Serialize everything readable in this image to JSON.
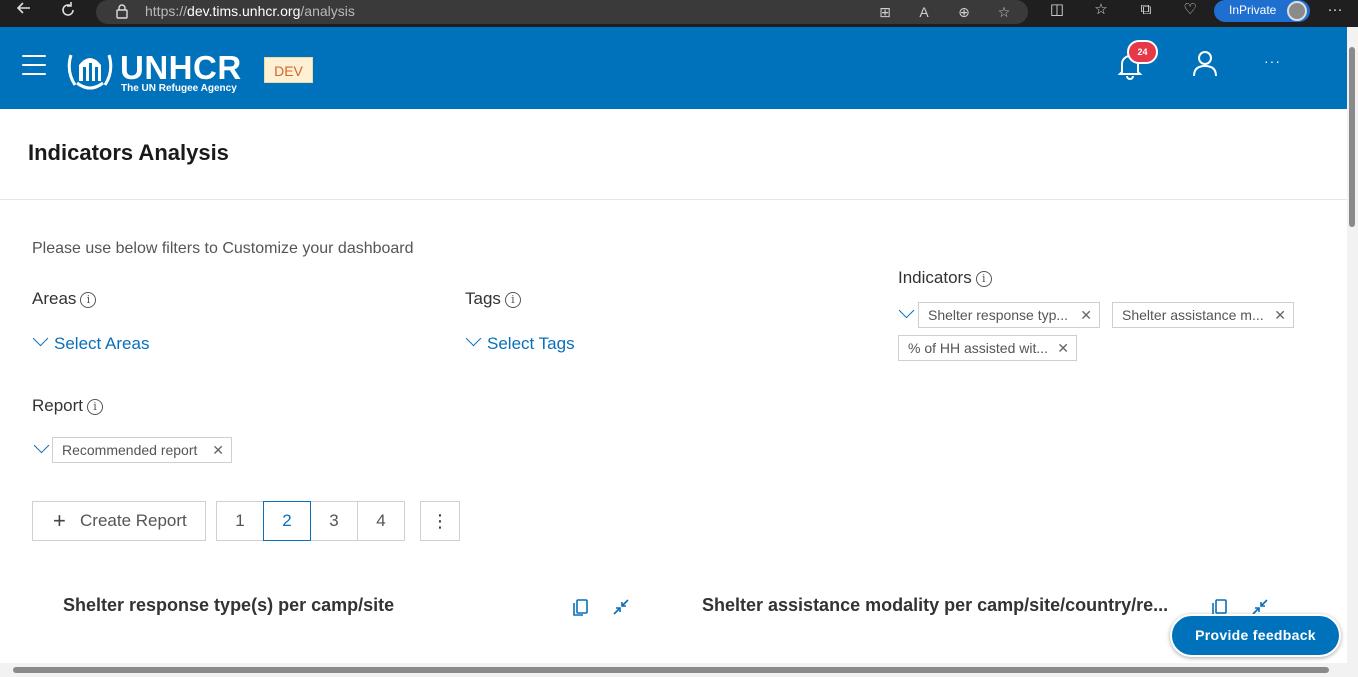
{
  "browser": {
    "url_prefix": "https://",
    "url_host": "dev.tims.unhcr.org",
    "url_path": "/analysis",
    "inprivate_label": "InPrivate",
    "more_label": "···"
  },
  "header": {
    "logo_text": "UNHCR",
    "logo_subtitle": "The UN Refugee Agency",
    "env_badge": "DEV",
    "notification_count": "24",
    "more_label": "···"
  },
  "page": {
    "title": "Indicators Analysis",
    "intro": "Please use below filters to Customize your dashboard"
  },
  "filters": {
    "areas": {
      "label": "Areas",
      "select_label": "Select Areas"
    },
    "tags": {
      "label": "Tags",
      "select_label": "Select Tags"
    },
    "indicators": {
      "label": "Indicators",
      "chips": [
        "Shelter response typ...",
        "Shelter assistance m...",
        "% of HH assisted wit..."
      ]
    },
    "report": {
      "label": "Report",
      "chips": [
        "Recommended report"
      ]
    }
  },
  "toolbar": {
    "create_label": "Create Report",
    "pages": [
      "1",
      "2",
      "3",
      "4"
    ],
    "active_page": "2",
    "kebab_label": "⋮"
  },
  "cards": [
    {
      "title": "Shelter response type(s) per camp/site"
    },
    {
      "title": "Shelter assistance modality per camp/site/country/re..."
    }
  ],
  "feedback_label": "Provide feedback",
  "colors": {
    "brand": "#0072bc",
    "link": "#0a6fb8",
    "badge": "#e5394a"
  }
}
